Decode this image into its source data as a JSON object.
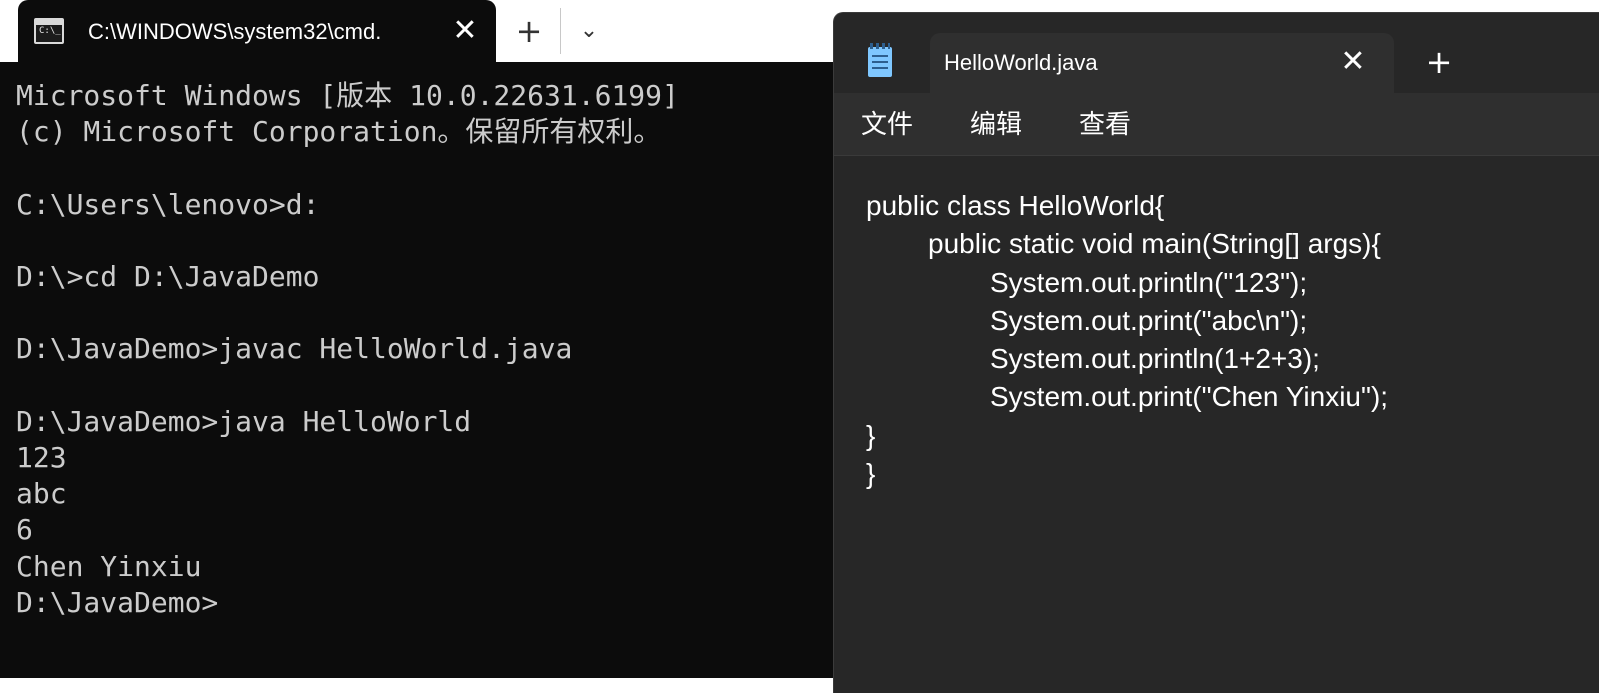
{
  "terminal": {
    "tab_title": "C:\\WINDOWS\\system32\\cmd.",
    "close_glyph": "✕",
    "new_tab_glyph": "+",
    "dropdown_glyph": "⌄",
    "icon": "cmd-icon",
    "icon_text": "C:\\_",
    "output": "Microsoft Windows [版本 10.0.22631.6199]\n(c) Microsoft Corporation。保留所有权利。\n\nC:\\Users\\lenovo>d:\n\nD:\\>cd D:\\JavaDemo\n\nD:\\JavaDemo>javac HelloWorld.java\n\nD:\\JavaDemo>java HelloWorld\n123\nabc\n6\nChen Yinxiu\nD:\\JavaDemo>"
  },
  "notepad": {
    "icon": "notepad-icon",
    "tab_title": "HelloWorld.java",
    "close_glyph": "✕",
    "new_tab_glyph": "+",
    "menu": [
      "文件",
      "编辑",
      "查看"
    ],
    "code_lines": [
      {
        "indent": 0,
        "text": "public class HelloWorld{"
      },
      {
        "indent": 1,
        "text": "public static void main(String[] args){"
      },
      {
        "indent": 2,
        "text": "System.out.println(\"123\");"
      },
      {
        "indent": 2,
        "text": "System.out.print(\"abc\\n\");"
      },
      {
        "indent": 2,
        "text": "System.out.println(1+2+3);"
      },
      {
        "indent": 2,
        "text": "System.out.print(\"Chen Yinxiu\");"
      },
      {
        "indent": 0,
        "text": "}"
      },
      {
        "indent": 0,
        "text": "}"
      }
    ]
  },
  "colors": {
    "terminal_bg": "#0c0c0c",
    "terminal_fg": "#cccccc",
    "notepad_bg": "#272727",
    "notepad_chrome": "#2f2f2f",
    "notepad_fg": "#ffffff"
  }
}
